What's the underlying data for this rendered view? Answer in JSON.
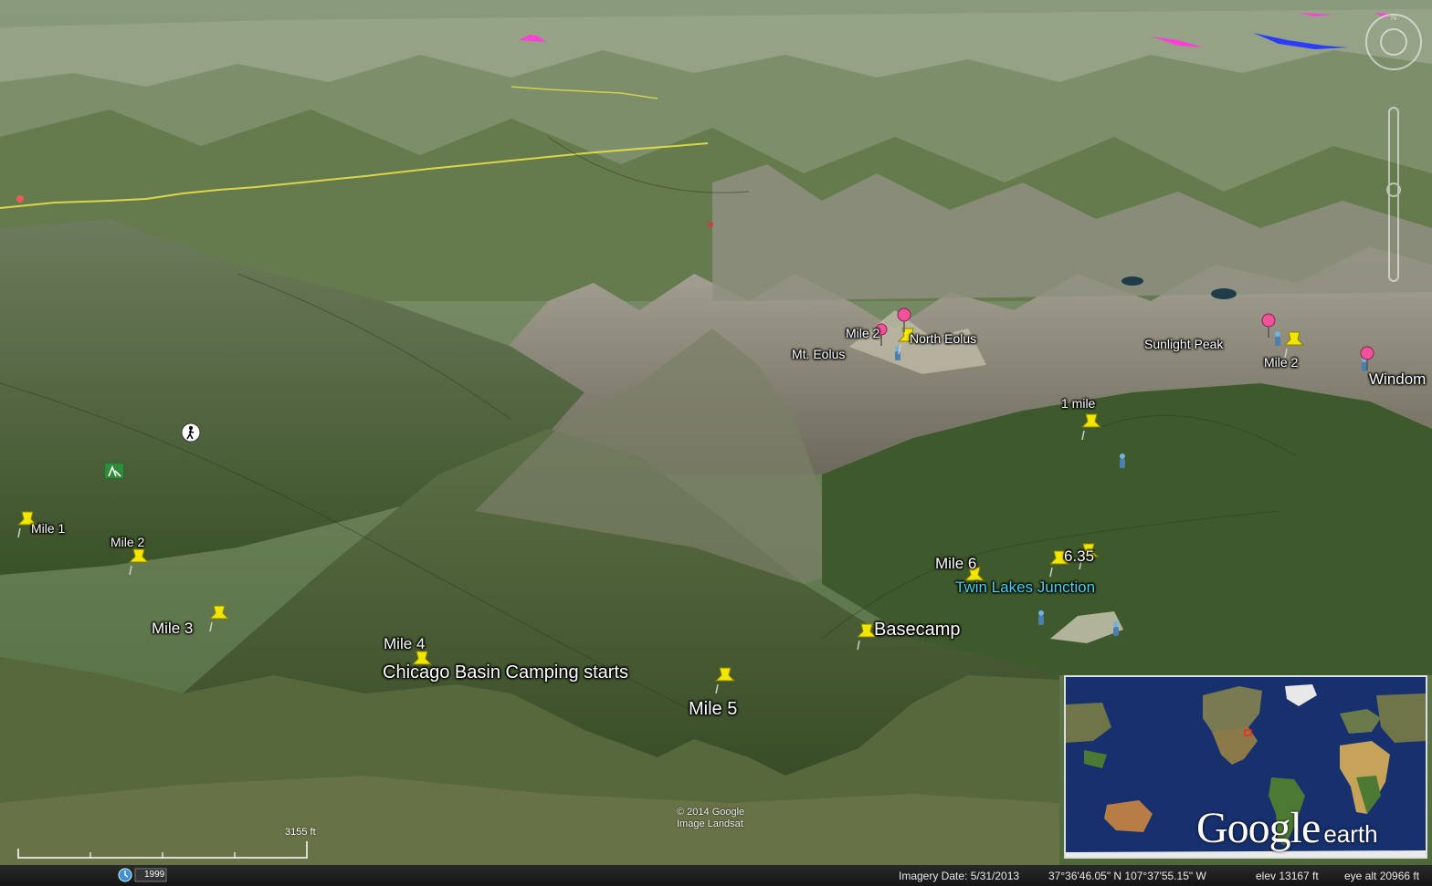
{
  "map": {
    "app": "Google earth",
    "labels": {
      "mile1_left": "Mile 1",
      "mile2_left": "Mile 2",
      "mile3": "Mile 3",
      "mile4": "Mile 4",
      "chicago_basin": "Chicago Basin Camping starts",
      "mile5": "Mile 5",
      "basecamp": "Basecamp",
      "mile6": "Mile 6",
      "m635": "6.35",
      "twin_lakes": "Twin Lakes Junction",
      "one_mile": "1 mile",
      "mile2_eolus": "Mile 2",
      "north_eolus": "North Eolus",
      "mt_eolus": "Mt. Eolus",
      "sunlight_peak": "Sunlight Peak",
      "mile2_right": "Mile 2",
      "windom": "Windom"
    },
    "colors": {
      "yellow_pin": "#f2e600",
      "pink_pin": "#f0539a",
      "trail_yellow": "#e8e04a",
      "label_cyan": "#3fd6f2",
      "route_magenta": "#ff3fd8",
      "route_blue": "#2b3cff"
    },
    "icons": [
      "pushpin-yellow-icon",
      "pushpin-pink-icon",
      "hiker-icon",
      "trailhead-icon",
      "camping-icon"
    ]
  },
  "overlay": {
    "copyright_line1": "© 2014 Google",
    "copyright_line2": "Image Landsat",
    "scale_label": "3155 ft",
    "history_year": "1999",
    "imagery_date": "Imagery Date: 5/31/2013",
    "coords": "37°36'46.05\" N  107°37'55.15\" W",
    "elev": "elev 13167 ft",
    "eye_alt": "eye alt  20966 ft",
    "logo_google": "Google",
    "logo_earth": "earth"
  }
}
